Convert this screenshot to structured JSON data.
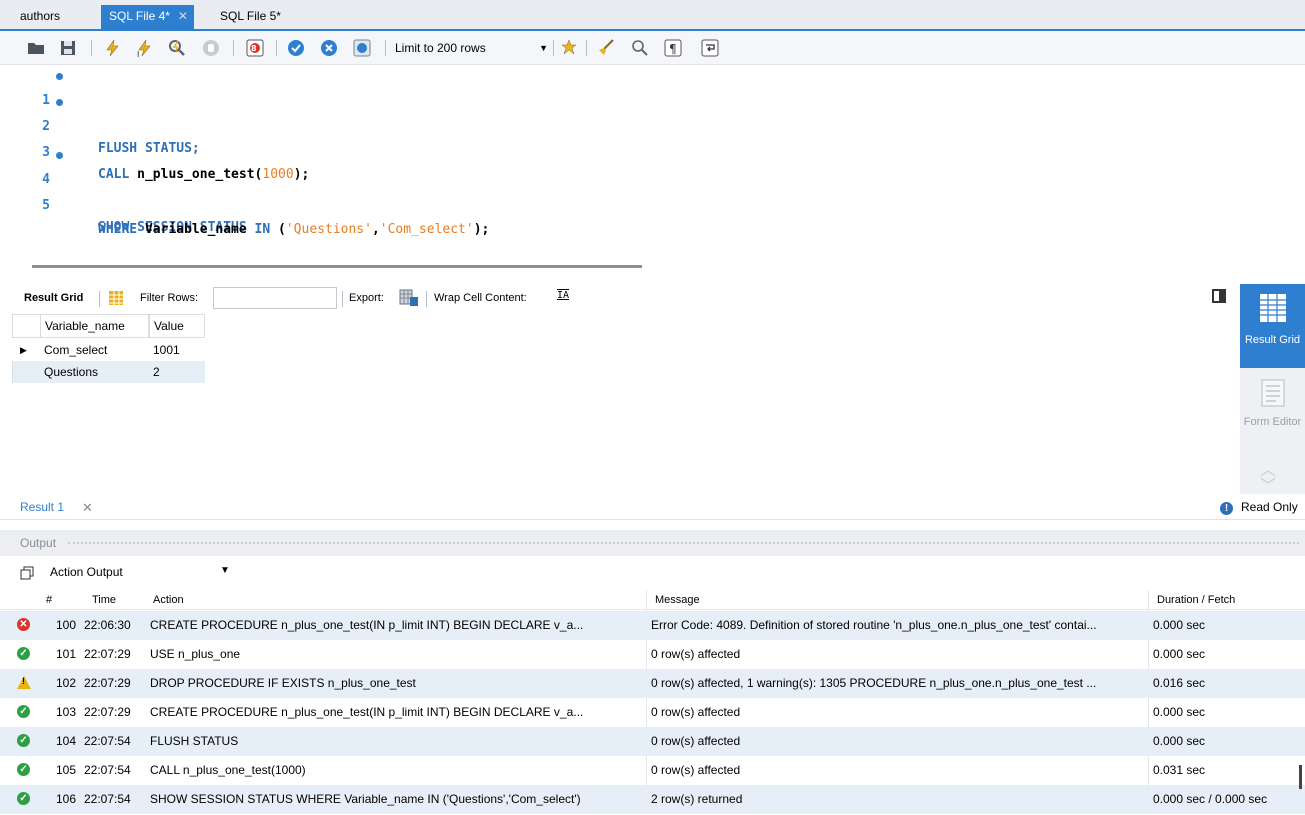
{
  "tabs": [
    {
      "label": "authors",
      "active": false,
      "closable": false
    },
    {
      "label": "SQL File 4*",
      "active": true,
      "closable": true
    },
    {
      "label": "SQL File 5*",
      "active": false,
      "closable": false
    }
  ],
  "toolbar": {
    "limit_select": "Limit to 200 rows",
    "icons": [
      "open-folder-icon",
      "save-icon",
      "execute-lightning-icon",
      "execute-current-lightning-icon",
      "explain-magnifier-icon",
      "stop-icon",
      "toggle-error-icon",
      "commit-check-icon",
      "rollback-x-icon",
      "autocommit-icon",
      "limit-dropdown",
      "beautify-star-icon",
      "broom-icon",
      "find-icon",
      "invisible-chars-icon",
      "wrap-icon"
    ]
  },
  "editor": {
    "lines": [
      {
        "num": "1",
        "dot": true
      },
      {
        "num": "2",
        "dot": true
      },
      {
        "num": "3",
        "dot": false
      },
      {
        "num": "4",
        "dot": true
      },
      {
        "num": "5",
        "dot": false
      }
    ],
    "tokens": {
      "l1_kw": "FLUSH STATUS;",
      "l2_kw": "CALL",
      "l2_fn": " n_plus_one_test(",
      "l2_num": "1000",
      "l2_end": ");",
      "l4_kw": "SHOW SESSION STATUS",
      "l5_kw1": "WHERE",
      "l5_mid": " Variable_name ",
      "l5_kw2": "IN",
      "l5_open": " (",
      "l5_s1": "'Questions'",
      "l5_comma": ",",
      "l5_s2": "'Com_select'",
      "l5_end": ");"
    }
  },
  "result_toolbar": {
    "result_grid_label": "Result Grid",
    "filter_rows_label": "Filter Rows:",
    "filter_value": "",
    "export_label": "Export:",
    "wrap_label": "Wrap Cell Content:"
  },
  "result_grid": {
    "columns": [
      "Variable_name",
      "Value"
    ],
    "rows": [
      [
        "Com_select",
        "1001"
      ],
      [
        "Questions",
        "2"
      ]
    ]
  },
  "side_panel": {
    "result_grid": "Result Grid",
    "form_editor": "Form Editor"
  },
  "result_tab": {
    "label": "Result 1",
    "read_only": "Read Only"
  },
  "output": {
    "title": "Output",
    "action_select": "Action Output",
    "columns": [
      "#",
      "Time",
      "Action",
      "Message",
      "Duration / Fetch"
    ],
    "rows": [
      {
        "status": "error",
        "num": "100",
        "time": "22:06:30",
        "action": "CREATE PROCEDURE n_plus_one_test(IN p_limit INT) BEGIN   DECLARE v_a...",
        "message": "Error Code: 4089. Definition of stored routine 'n_plus_one.n_plus_one_test' contai...",
        "duration": "0.000 sec"
      },
      {
        "status": "ok",
        "num": "101",
        "time": "22:07:29",
        "action": "USE n_plus_one",
        "message": "0 row(s) affected",
        "duration": "0.000 sec"
      },
      {
        "status": "warning",
        "num": "102",
        "time": "22:07:29",
        "action": "DROP PROCEDURE IF EXISTS n_plus_one_test",
        "message": "0 row(s) affected, 1 warning(s): 1305 PROCEDURE n_plus_one.n_plus_one_test ...",
        "duration": "0.016 sec"
      },
      {
        "status": "ok",
        "num": "103",
        "time": "22:07:29",
        "action": "CREATE PROCEDURE n_plus_one_test(IN p_limit INT) BEGIN   DECLARE v_a...",
        "message": "0 row(s) affected",
        "duration": "0.000 sec"
      },
      {
        "status": "ok",
        "num": "104",
        "time": "22:07:54",
        "action": "FLUSH STATUS",
        "message": "0 row(s) affected",
        "duration": "0.000 sec"
      },
      {
        "status": "ok",
        "num": "105",
        "time": "22:07:54",
        "action": "CALL n_plus_one_test(1000)",
        "message": "0 row(s) affected",
        "duration": "0.031 sec"
      },
      {
        "status": "ok",
        "num": "106",
        "time": "22:07:54",
        "action": "SHOW SESSION STATUS WHERE Variable_name IN ('Questions','Com_select')",
        "message": "2 row(s) returned",
        "duration": "0.000 sec / 0.000 sec"
      }
    ]
  },
  "colors": {
    "accent": "#2e7fcf",
    "keyword": "#2e6fb8",
    "literal": "#e67e22",
    "row_alt": "#e6eef8",
    "ok": "#2ea043",
    "error": "#d9342b",
    "warning": "#e7b416"
  }
}
